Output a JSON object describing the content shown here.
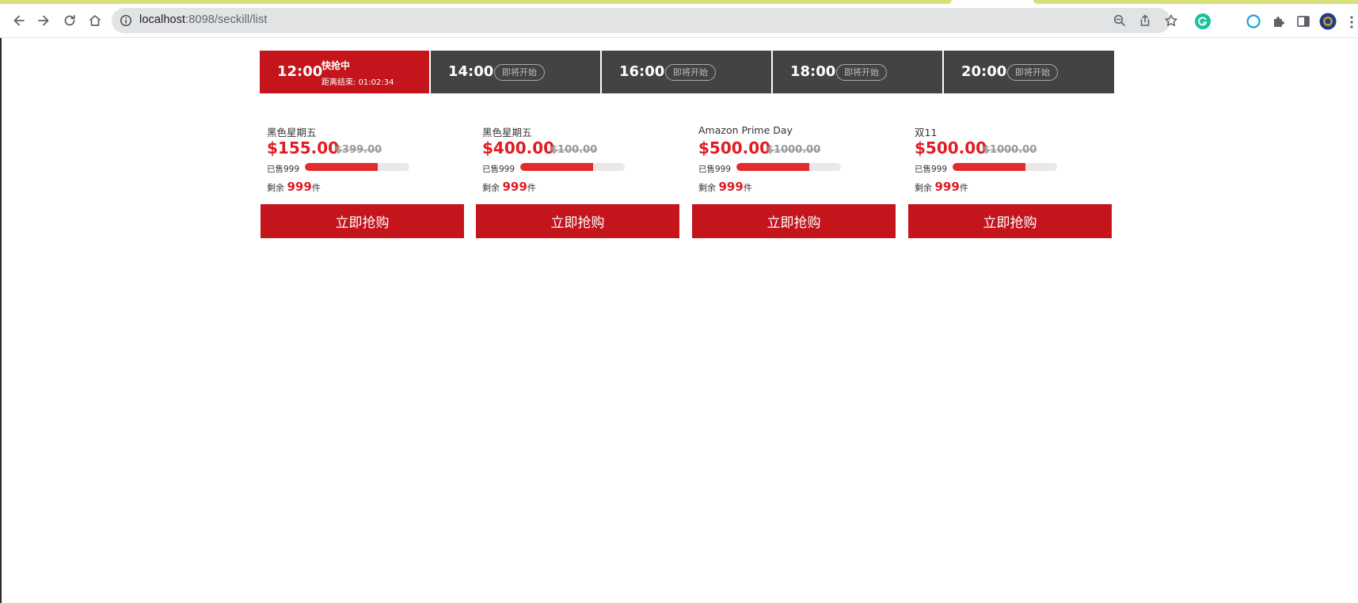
{
  "browser": {
    "url_host": "localhost",
    "url_rest": ":8098/seckill/list"
  },
  "timebar": {
    "active": {
      "time": "12:00",
      "status": "快抢中",
      "countdown_label": "距离结束:",
      "countdown_value": "01:02:34"
    },
    "upcoming": [
      {
        "time": "14:00",
        "badge": "即将开始"
      },
      {
        "time": "16:00",
        "badge": "即将开始"
      },
      {
        "time": "18:00",
        "badge": "即将开始"
      },
      {
        "time": "20:00",
        "badge": "即将开始"
      }
    ]
  },
  "products": [
    {
      "name": "黑色星期五",
      "price": "$155.00",
      "original": "$399.00",
      "sold_label": "已售999",
      "progress_fraction": 0.7,
      "remain_prefix": "剩余",
      "remain_count": "999",
      "remain_unit": "件",
      "buy_label": "立即抢购"
    },
    {
      "name": "黑色星期五",
      "price": "$400.00",
      "original": "$100.00",
      "sold_label": "已售999",
      "progress_fraction": 0.7,
      "remain_prefix": "剩余",
      "remain_count": "999",
      "remain_unit": "件",
      "buy_label": "立即抢购"
    },
    {
      "name": "Amazon Prime Day",
      "price": "$500.00",
      "original": "$1000.00",
      "sold_label": "已售999",
      "progress_fraction": 0.7,
      "remain_prefix": "剩余",
      "remain_count": "999",
      "remain_unit": "件",
      "buy_label": "立即抢购"
    },
    {
      "name": "双11",
      "price": "$500.00",
      "original": "$1000.00",
      "sold_label": "已售999",
      "progress_fraction": 0.7,
      "remain_prefix": "剩余",
      "remain_count": "999",
      "remain_unit": "件",
      "buy_label": "立即抢购"
    }
  ],
  "colors": {
    "accent_red": "#c4141c",
    "price_red": "#e01b22",
    "slot_dark": "#434343"
  }
}
